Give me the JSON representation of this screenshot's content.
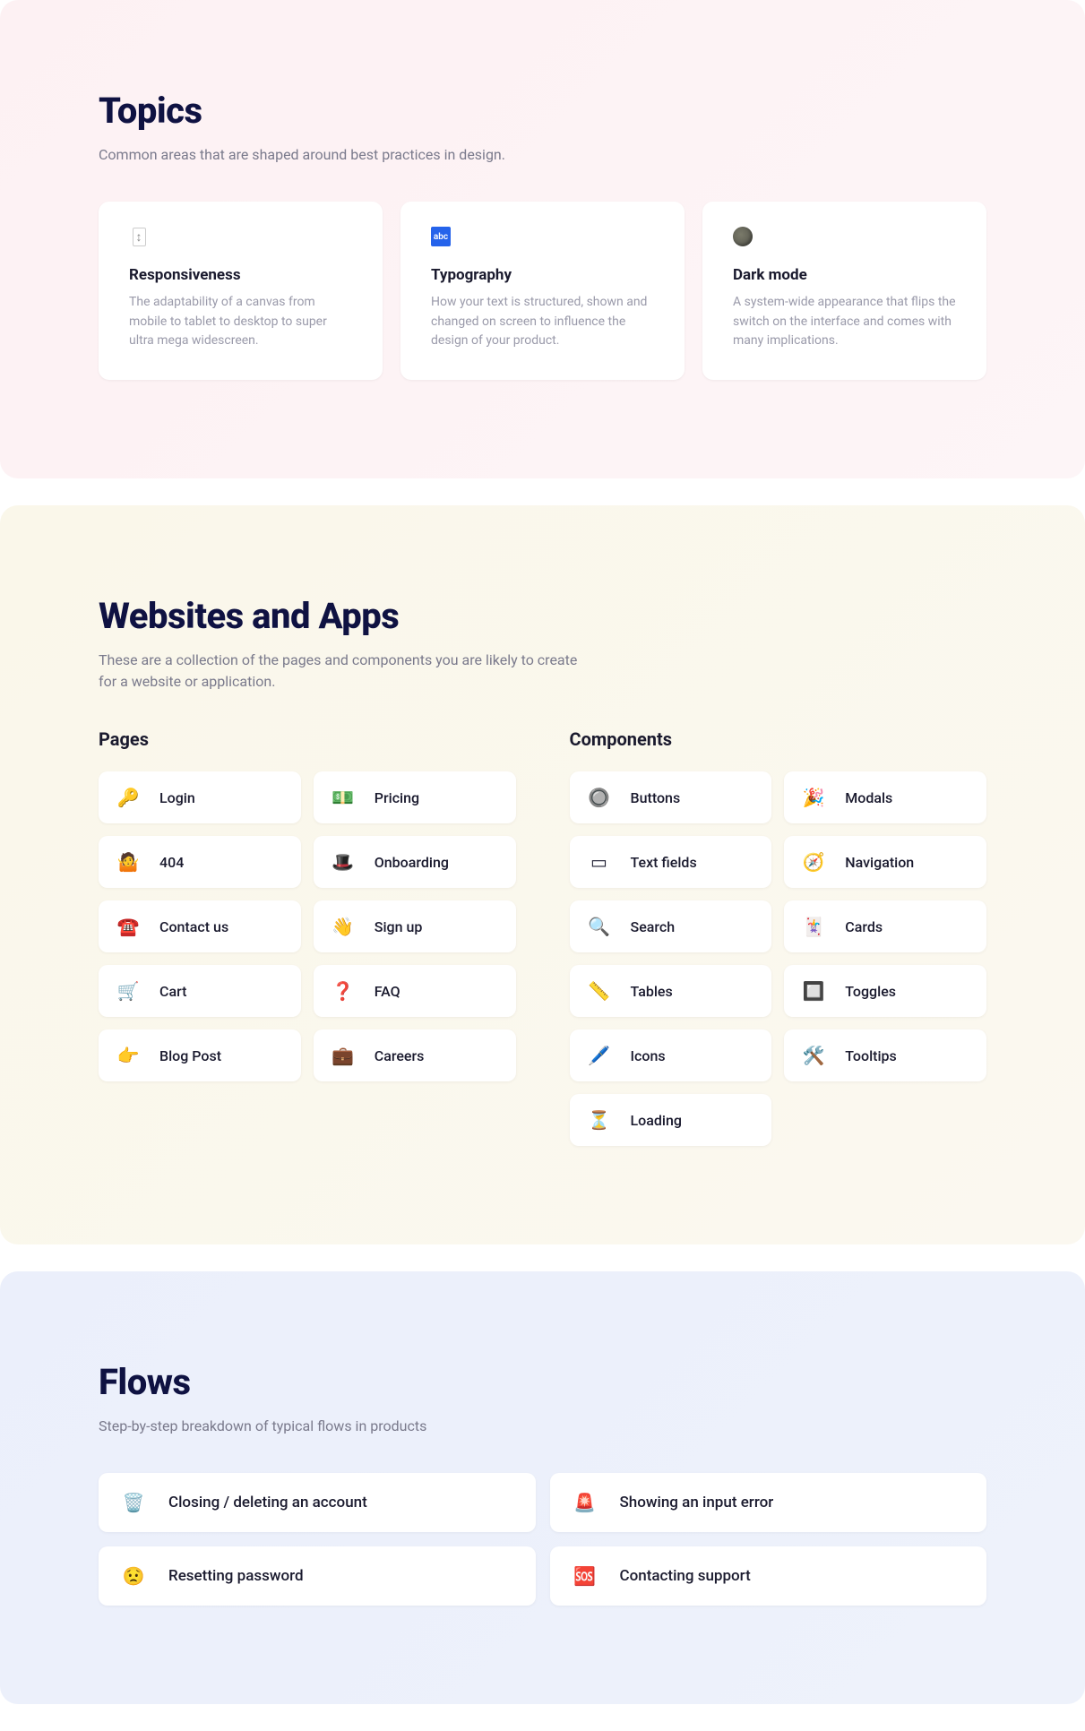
{
  "topics": {
    "title": "Topics",
    "subtitle": "Common areas that are shaped around best practices in design.",
    "cards": [
      {
        "icon": "↕",
        "iconName": "resize-icon",
        "title": "Responsiveness",
        "desc": "The adaptability of a canvas from mobile to tablet to desktop to super ultra mega widescreen."
      },
      {
        "icon": "abc",
        "iconName": "abc-icon",
        "title": "Typography",
        "desc": "How your text is structured, shown and changed on screen to influence the design of your product."
      },
      {
        "icon": "",
        "iconName": "moon-icon",
        "title": "Dark mode",
        "desc": "A system-wide appearance that flips the switch on the interface and comes with many implications."
      }
    ]
  },
  "websites": {
    "title": "Websites and Apps",
    "subtitle": "These are a collection of the pages and components you are likely to create for a website or application.",
    "pages": {
      "title": "Pages",
      "items": [
        {
          "icon": "🔑",
          "iconName": "key-icon",
          "label": "Login"
        },
        {
          "icon": "💵",
          "iconName": "money-icon",
          "label": "Pricing"
        },
        {
          "icon": "🤷",
          "iconName": "shrug-icon",
          "label": "404"
        },
        {
          "icon": "🎩",
          "iconName": "tophat-icon",
          "label": "Onboarding"
        },
        {
          "icon": "☎️",
          "iconName": "phone-icon",
          "label": "Contact us"
        },
        {
          "icon": "👋",
          "iconName": "wave-icon",
          "label": "Sign up"
        },
        {
          "icon": "🛒",
          "iconName": "cart-icon",
          "label": "Cart"
        },
        {
          "icon": "❓",
          "iconName": "question-icon",
          "label": "FAQ"
        },
        {
          "icon": "👉",
          "iconName": "point-icon",
          "label": "Blog Post"
        },
        {
          "icon": "💼",
          "iconName": "briefcase-icon",
          "label": "Careers"
        }
      ]
    },
    "components": {
      "title": "Components",
      "items": [
        {
          "icon": "🔘",
          "iconName": "button-icon",
          "label": "Buttons"
        },
        {
          "icon": "🎉",
          "iconName": "party-icon",
          "label": "Modals"
        },
        {
          "icon": "▭",
          "iconName": "textfield-icon",
          "label": "Text fields"
        },
        {
          "icon": "🧭",
          "iconName": "compass-icon",
          "label": "Navigation"
        },
        {
          "icon": "🔍",
          "iconName": "search-icon",
          "label": "Search"
        },
        {
          "icon": "🃏",
          "iconName": "card-icon",
          "label": "Cards"
        },
        {
          "icon": "📏",
          "iconName": "ruler-icon",
          "label": "Tables"
        },
        {
          "icon": "🔲",
          "iconName": "toggle-icon",
          "label": "Toggles"
        },
        {
          "icon": "🖊️",
          "iconName": "pen-icon",
          "label": "Icons"
        },
        {
          "icon": "🛠️",
          "iconName": "tools-icon",
          "label": "Tooltips"
        },
        {
          "icon": "⏳",
          "iconName": "hourglass-icon",
          "label": "Loading"
        }
      ]
    }
  },
  "flows": {
    "title": "Flows",
    "subtitle": "Step-by-step breakdown of typical flows in products",
    "items": [
      {
        "icon": "🗑️",
        "iconName": "trash-icon",
        "label": "Closing / deleting an account"
      },
      {
        "icon": "🚨",
        "iconName": "alert-icon",
        "label": "Showing an input error"
      },
      {
        "icon": "😟",
        "iconName": "worried-icon",
        "label": "Resetting password"
      },
      {
        "icon": "🆘",
        "iconName": "sos-icon",
        "label": "Contacting support"
      }
    ]
  }
}
